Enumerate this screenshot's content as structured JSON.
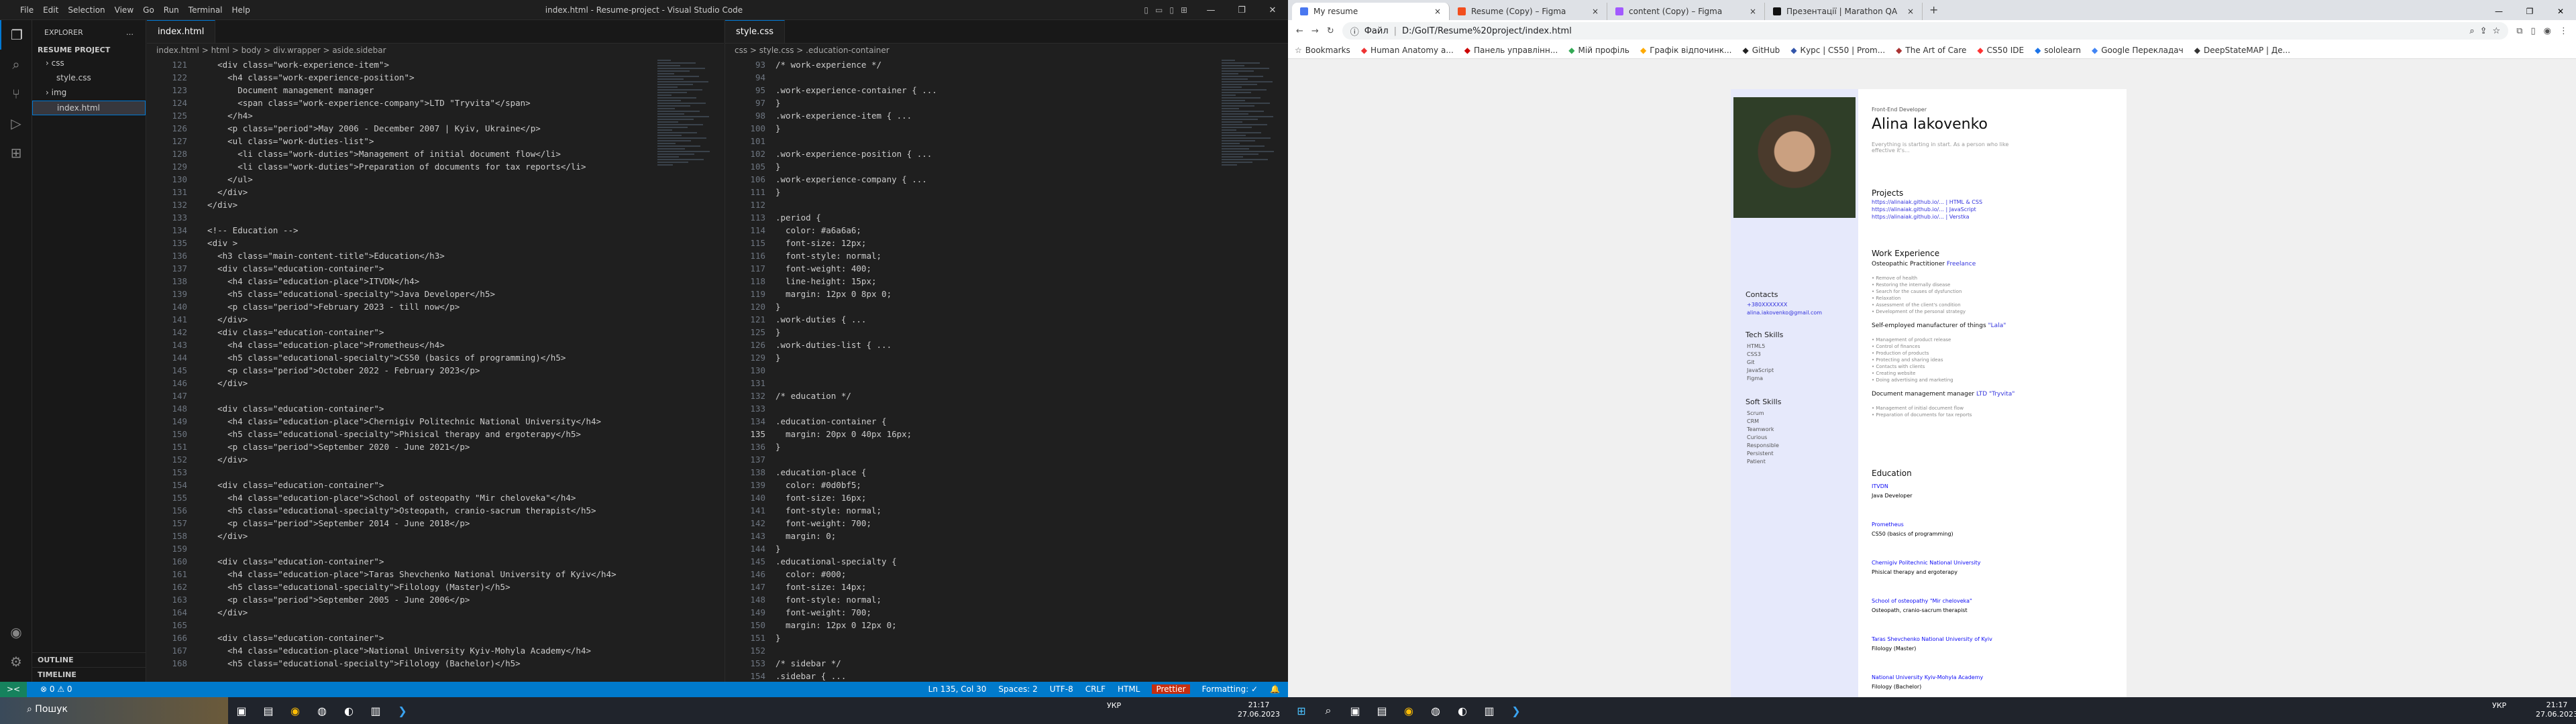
{
  "vscode": {
    "menu": [
      "File",
      "Edit",
      "Selection",
      "View",
      "Go",
      "Run",
      "Terminal",
      "Help"
    ],
    "title": "index.html - Resume-project - Visual Studio Code",
    "explorer_label": "EXPLORER",
    "project": "RESUME PROJECT",
    "files": [
      {
        "name": "css",
        "type": "folder"
      },
      {
        "name": "style.css",
        "type": "file"
      },
      {
        "name": "img",
        "type": "folder"
      },
      {
        "name": "index.html",
        "type": "file"
      }
    ],
    "outline": "OUTLINE",
    "timeline": "TIMELINE",
    "left_tab": "index.html",
    "left_crumbs": "index.html > html > body > div.wrapper > aside.sidebar",
    "left_code": [
      [
        "121",
        "    <div class=\"work-experience-item\">"
      ],
      [
        "122",
        "      <h4 class=\"work-experience-position\">"
      ],
      [
        "123",
        "        Document management manager"
      ],
      [
        "124",
        "        <span class=\"work-experience-company\">LTD \"Tryvita\"</span>"
      ],
      [
        "125",
        "      </h4>"
      ],
      [
        "126",
        "      <p class=\"period\">May 2006 - December 2007 | Kyiv, Ukraine</p>"
      ],
      [
        "127",
        "      <ul class=\"work-duties-list\">"
      ],
      [
        "128",
        "        <li class=\"work-duties\">Management of initial document flow</li>"
      ],
      [
        "129",
        "        <li class=\"work-duties\">Preparation of documents for tax reports</li>"
      ],
      [
        "130",
        "      </ul>"
      ],
      [
        "131",
        "    </div>"
      ],
      [
        "132",
        "  </div>"
      ],
      [
        "133",
        ""
      ],
      [
        "134",
        "  <!-- Education -->"
      ],
      [
        "135",
        "  <div >"
      ],
      [
        "136",
        "    <h3 class=\"main-content-title\">Education</h3>"
      ],
      [
        "137",
        "    <div class=\"education-container\">"
      ],
      [
        "138",
        "      <h4 class=\"education-place\">ITVDN</h4>"
      ],
      [
        "139",
        "      <h5 class=\"educational-specialty\">Java Developer</h5>"
      ],
      [
        "140",
        "      <p class=\"period\">February 2023 - till now</p>"
      ],
      [
        "141",
        "    </div>"
      ],
      [
        "142",
        "    <div class=\"education-container\">"
      ],
      [
        "143",
        "      <h4 class=\"education-place\">Prometheus</h4>"
      ],
      [
        "144",
        "      <h5 class=\"educational-specialty\">CS50 (basics of programming)</h5>"
      ],
      [
        "145",
        "      <p class=\"period\">October 2022 - February 2023</p>"
      ],
      [
        "146",
        "    </div>"
      ],
      [
        "147",
        ""
      ],
      [
        "148",
        "    <div class=\"education-container\">"
      ],
      [
        "149",
        "      <h4 class=\"education-place\">Chernigiv Politechnic National University</h4>"
      ],
      [
        "150",
        "      <h5 class=\"educational-specialty\">Phisical therapy and ergoterapy</h5>"
      ],
      [
        "151",
        "      <p class=\"period\">September 2020 - June 2021</p>"
      ],
      [
        "152",
        "    </div>"
      ],
      [
        "153",
        ""
      ],
      [
        "154",
        "    <div class=\"education-container\">"
      ],
      [
        "155",
        "      <h4 class=\"education-place\">School of osteopathy \"Mir cheloveka\"</h4>"
      ],
      [
        "156",
        "      <h5 class=\"educational-specialty\">Osteopath, cranio-sacrum therapist</h5>"
      ],
      [
        "157",
        "      <p class=\"period\">September 2014 - June 2018</p>"
      ],
      [
        "158",
        "    </div>"
      ],
      [
        "159",
        ""
      ],
      [
        "160",
        "    <div class=\"education-container\">"
      ],
      [
        "161",
        "      <h4 class=\"education-place\">Taras Shevchenko National University of Kyiv</h4>"
      ],
      [
        "162",
        "      <h5 class=\"educational-specialty\">Filology (Master)</h5>"
      ],
      [
        "163",
        "      <p class=\"period\">September 2005 - June 2006</p>"
      ],
      [
        "164",
        "    </div>"
      ],
      [
        "165",
        ""
      ],
      [
        "166",
        "    <div class=\"education-container\">"
      ],
      [
        "167",
        "      <h4 class=\"education-place\">National University Kyiv-Mohyla Academy</h4>"
      ],
      [
        "168",
        "      <h5 class=\"educational-specialty\">Filology (Bachelor)</h5>"
      ]
    ],
    "right_tab": "style.css",
    "right_crumbs": "css > style.css > .education-container",
    "right_code": [
      [
        "93",
        "/* work-experience */"
      ],
      [
        "94",
        ""
      ],
      [
        "95",
        ".work-experience-container { ..."
      ],
      [
        "97",
        "}"
      ],
      [
        "98",
        ".work-experience-item { ..."
      ],
      [
        "100",
        "}"
      ],
      [
        "101",
        ""
      ],
      [
        "102",
        ".work-experience-position { ..."
      ],
      [
        "105",
        "}"
      ],
      [
        "106",
        ".work-experience-company { ..."
      ],
      [
        "111",
        "}"
      ],
      [
        "112",
        ""
      ],
      [
        "113",
        ".period {"
      ],
      [
        "114",
        "  color: #a6a6a6;"
      ],
      [
        "115",
        "  font-size: 12px;"
      ],
      [
        "116",
        "  font-style: normal;"
      ],
      [
        "117",
        "  font-weight: 400;"
      ],
      [
        "118",
        "  line-height: 15px;"
      ],
      [
        "119",
        "  margin: 12px 0 8px 0;"
      ],
      [
        "120",
        "}"
      ],
      [
        "121",
        ".work-duties { ..."
      ],
      [
        "125",
        "}"
      ],
      [
        "126",
        ".work-duties-list { ..."
      ],
      [
        "129",
        "}"
      ],
      [
        "130",
        ""
      ],
      [
        "131",
        ""
      ],
      [
        "132",
        "/* education */"
      ],
      [
        "133",
        ""
      ],
      [
        "134",
        ".education-container {"
      ],
      [
        "135",
        "  margin: 20px 0 40px 16px;"
      ],
      [
        "136",
        "}"
      ],
      [
        "137",
        ""
      ],
      [
        "138",
        ".education-place {"
      ],
      [
        "139",
        "  color: #0d0bf5;"
      ],
      [
        "140",
        "  font-size: 16px;"
      ],
      [
        "141",
        "  font-style: normal;"
      ],
      [
        "142",
        "  font-weight: 700;"
      ],
      [
        "143",
        "  margin: 0;"
      ],
      [
        "144",
        "}"
      ],
      [
        "145",
        ".educational-specialty {"
      ],
      [
        "146",
        "  color: #000;"
      ],
      [
        "147",
        "  font-size: 14px;"
      ],
      [
        "148",
        "  font-style: normal;"
      ],
      [
        "149",
        "  font-weight: 700;"
      ],
      [
        "150",
        "  margin: 12px 0 12px 0;"
      ],
      [
        "151",
        "}"
      ],
      [
        "152",
        ""
      ],
      [
        "153",
        "/* sidebar */"
      ],
      [
        "154",
        ".sidebar { ..."
      ]
    ],
    "status": {
      "remote": "><",
      "errors": "⊗ 0 ⚠ 0",
      "pos": "Ln 135, Col 30",
      "spaces": "Spaces: 2",
      "enc": "UTF-8",
      "eol": "CRLF",
      "lang": "HTML",
      "prettier": "Prettier",
      "fmt": "Formatting: ✓"
    }
  },
  "chrome": {
    "tabs": [
      {
        "title": "My resume",
        "color": "#4a78f0"
      },
      {
        "title": "Resume (Copy) – Figma",
        "color": "#f24e1e"
      },
      {
        "title": "content (Copy) – Figma",
        "color": "#a259ff"
      },
      {
        "title": "Презентації | Marathon QA",
        "color": "#111111"
      }
    ],
    "url_prefix": "Файл",
    "url": "D:/GoIT/Resume%20project/index.html",
    "bookmarks": [
      "Bookmarks",
      "Human Anatomy a...",
      "Панель управлінн...",
      "Мій профіль",
      "Графік відпочинк...",
      "GitHub",
      "Курс | CS50 | Prom...",
      "The Art of Care",
      "CS50 IDE",
      "sololearn",
      "Google Перекладач",
      "DeepStateMAP | Де..."
    ]
  },
  "resume": {
    "role": "Front-End Developer",
    "name": "Alina Iakovenko",
    "intro": "Everything is starting in start. As a person who like effective it's...",
    "projects_title": "Projects",
    "projects": [
      "https://alinaiak.github.io/... | HTML & CSS",
      "https://alinaiak.github.io/... | JavaScript",
      "https://alinaiak.github.io/... | Verstka"
    ],
    "contacts_title": "Contacts",
    "contacts": [
      "+380XXXXXXX",
      "alina.iakovenko@gmail.com"
    ],
    "tech_title": "Tech Skills",
    "tech": [
      "HTML5",
      "CSS3",
      "Git",
      "JavaScript",
      "Figma"
    ],
    "soft_title": "Soft Skills",
    "soft": [
      "Scrum",
      "CRM",
      "Teamwork",
      "Curious",
      "Responsible",
      "Persistent",
      "Patient"
    ],
    "work_title": "Work Experience",
    "work": [
      {
        "pos": "Osteopathic Practitioner",
        "company": "Freelance",
        "duties": [
          "Remove of health",
          "Restoring the internally disease",
          "Search for the causes of dysfunction",
          "Relaxation",
          "Assessment of the client's condition",
          "Development of the personal strategy"
        ]
      },
      {
        "pos": "Self-employed manufacturer of things",
        "company": "\"Lala\"",
        "duties": [
          "Management of product release",
          "Control of finances",
          "Production of products",
          "Protecting and sharing ideas",
          "Contacts with clients",
          "Creating website",
          "Doing advertising and marketing"
        ]
      },
      {
        "pos": "Document management manager",
        "company": "LTD \"Tryvita\"",
        "duties": [
          "Management of initial document flow",
          "Preparation of documents for tax reports"
        ]
      }
    ],
    "edu_title": "Education",
    "edu": [
      {
        "place": "ITVDN",
        "spec": "Java Developer"
      },
      {
        "place": "Prometheus",
        "spec": "CS50 (basics of programming)"
      },
      {
        "place": "Chernigiv Politechnic National University",
        "spec": "Phisical therapy and ergoterapy"
      },
      {
        "place": "School of osteopathy \"Mir cheloveka\"",
        "spec": "Osteopath, cranio-sacrum therapist"
      },
      {
        "place": "Taras Shevchenko National University of Kyiv",
        "spec": "Filology (Master)"
      },
      {
        "place": "National University Kyiv-Mohyla Academy",
        "spec": "Filology (Bachelor)"
      }
    ]
  },
  "taskbar": {
    "search": "Пошук",
    "lang_left": "УКР",
    "time_left": "21:17",
    "date_left": "27.06.2023",
    "lang_right": "УКР",
    "time_right": "21:17",
    "date_right": "27.06.2023"
  }
}
